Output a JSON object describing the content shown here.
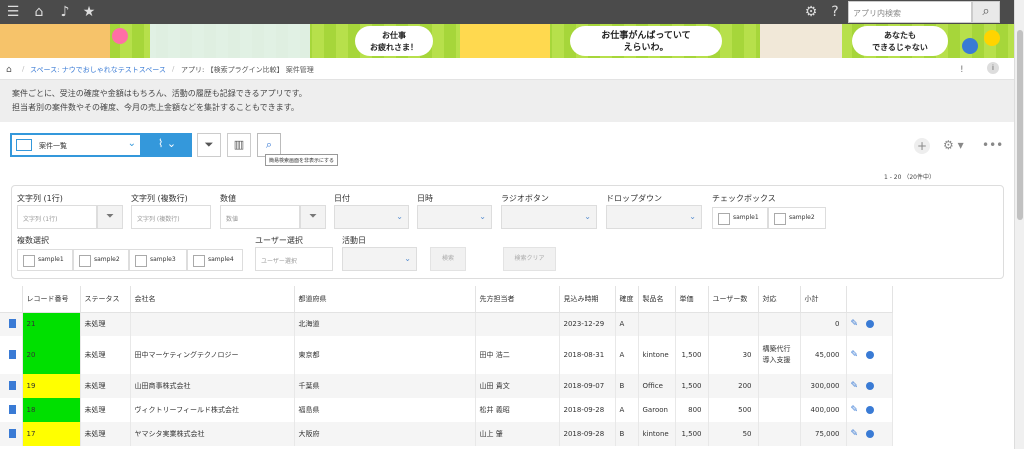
{
  "topbar": {
    "icons": [
      "menu-icon",
      "home-icon",
      "bell-icon",
      "star-icon",
      "gear-icon",
      "help-icon"
    ],
    "search_placeholder": "アプリ内検索"
  },
  "banner": {
    "bubble1": "お仕事\nお疲れさま！",
    "bubble2": "お仕事がんばっていて\nえらいわ。",
    "bubble3": "あなたも\nできるじゃない"
  },
  "breadcrumb": {
    "space": "スペース: ナウでおしゃれなテストスペース",
    "app": "アプリ: 【検索プラグイン比較】 案件管理"
  },
  "description": {
    "line1": "案件ごとに、受注の確度や金額はもちろん、活動の履歴も記録できるアプリです。",
    "line2": "担当者別の案件数やその確度、今月の売上金額などを集計することもできます。"
  },
  "toolbar": {
    "view_label": "案件一覧",
    "tooltip": "簡易検索画面を非表示にする",
    "pager": "1 - 20 （20件中）"
  },
  "filter": {
    "text_single_label": "文字列 (1行)",
    "text_single_placeholder": "文字列 (1行)",
    "text_multi_label": "文字列 (複数行)",
    "text_multi_placeholder": "文字列 (複数行)",
    "number_label": "数値",
    "number_placeholder": "数値",
    "date_label": "日付",
    "datetime_label": "日時",
    "radio_label": "ラジオボタン",
    "dropdown_label": "ドロップダウン",
    "checkbox_label": "チェックボックス",
    "checkbox_options": [
      "sample1",
      "sample2"
    ],
    "multi_select_label": "複数選択",
    "multi_select_options": [
      "sample1",
      "sample2",
      "sample3",
      "sample4"
    ],
    "user_select_label": "ユーザー選択",
    "user_select_placeholder": "ユーザー選択",
    "activity_date_label": "活動日",
    "search_button": "検索",
    "clear_button": "検索クリア"
  },
  "table": {
    "headers": [
      "レコード番号",
      "ステータス",
      "会社名",
      "都道府県",
      "先方担当者",
      "見込み時期",
      "確度",
      "製品名",
      "単価",
      "ユーザー数",
      "対応",
      "小計"
    ],
    "rows": [
      {
        "id": "21",
        "status": "未処理",
        "company": "",
        "pref": "北海道",
        "contact": "",
        "date": "2023-12-29",
        "rank": "A",
        "product": "",
        "price": "",
        "users": "",
        "support": "",
        "subtotal": "0",
        "color": "#00e000"
      },
      {
        "id": "20",
        "status": "未処理",
        "company": "田中マーケティングテクノロジー",
        "pref": "東京都",
        "contact": "田中 浩二",
        "date": "2018-08-31",
        "rank": "A",
        "product": "kintone",
        "price": "1,500",
        "users": "30",
        "support": "構築代行\n導入支援",
        "subtotal": "45,000",
        "color": "#00e000"
      },
      {
        "id": "19",
        "status": "未処理",
        "company": "山田商事株式会社",
        "pref": "千葉県",
        "contact": "山田 貴文",
        "date": "2018-09-07",
        "rank": "B",
        "product": "Office",
        "price": "1,500",
        "users": "200",
        "support": "",
        "subtotal": "300,000",
        "color": "#ffff00"
      },
      {
        "id": "18",
        "status": "未処理",
        "company": "ヴィクトリーフィールド株式会社",
        "pref": "福島県",
        "contact": "松井 義昭",
        "date": "2018-09-28",
        "rank": "A",
        "product": "Garoon",
        "price": "800",
        "users": "500",
        "support": "",
        "subtotal": "400,000",
        "color": "#00e000"
      },
      {
        "id": "17",
        "status": "未処理",
        "company": "ヤマシタ実業株式会社",
        "pref": "大阪府",
        "contact": "山上 肇",
        "date": "2018-09-28",
        "rank": "B",
        "product": "kintone",
        "price": "1,500",
        "users": "50",
        "support": "",
        "subtotal": "75,000",
        "color": "#ffff00"
      }
    ]
  }
}
